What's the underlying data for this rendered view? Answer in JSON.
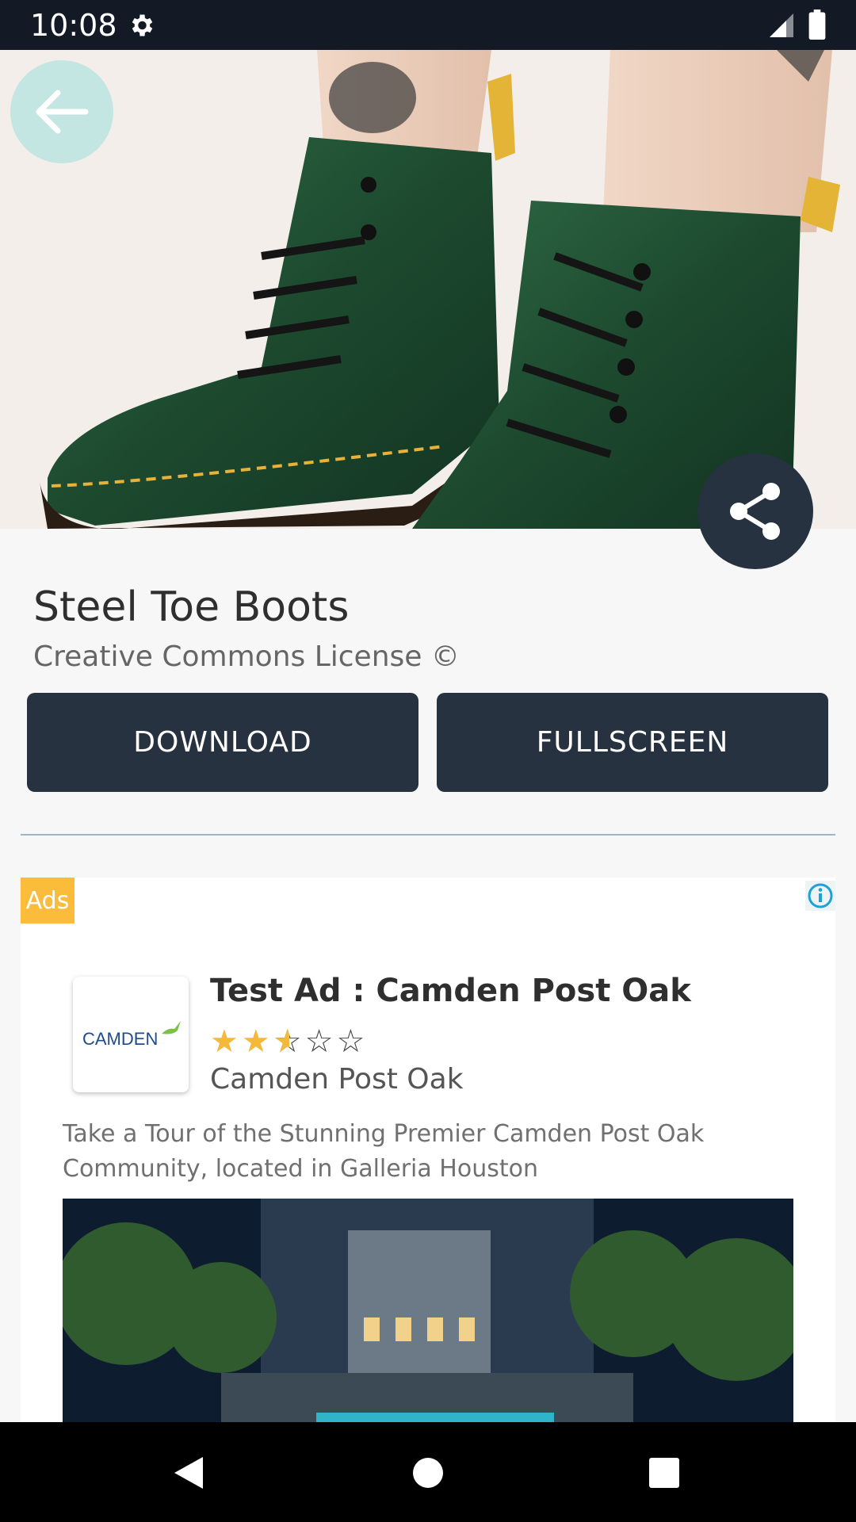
{
  "status_bar": {
    "time": "10:08",
    "icons": [
      "gear-icon",
      "cell-signal-icon",
      "battery-icon"
    ]
  },
  "hero": {
    "image": "green leather lace-up boots photo",
    "back_icon": "arrow-left-icon",
    "share_icon": "share-icon"
  },
  "content": {
    "title": "Steel Toe Boots",
    "subtitle": "Creative Commons License ©",
    "buttons": {
      "download": "DOWNLOAD",
      "fullscreen": "FULLSCREEN"
    }
  },
  "ad": {
    "badge": "Ads",
    "info_icon": "info-icon",
    "logo_text": "CAMDEN",
    "title": "Test Ad : Camden Post Oak",
    "rating": 2.5,
    "rating_max": 5,
    "advertiser": "Camden Post Oak",
    "body": "Take a Tour of the Stunning Premier Camden Post Oak Community, located in Galleria Houston",
    "image": "night view of apartment pool courtyard"
  },
  "nav_bar": {
    "icons": [
      "nav-back-icon",
      "nav-home-icon",
      "nav-recents-icon"
    ]
  },
  "colors": {
    "status_bar": "#131a26",
    "button_bg": "#273240",
    "ads_badge": "#fbbc3c",
    "star": "#f4b93b",
    "divider": "#9fb5c6"
  }
}
